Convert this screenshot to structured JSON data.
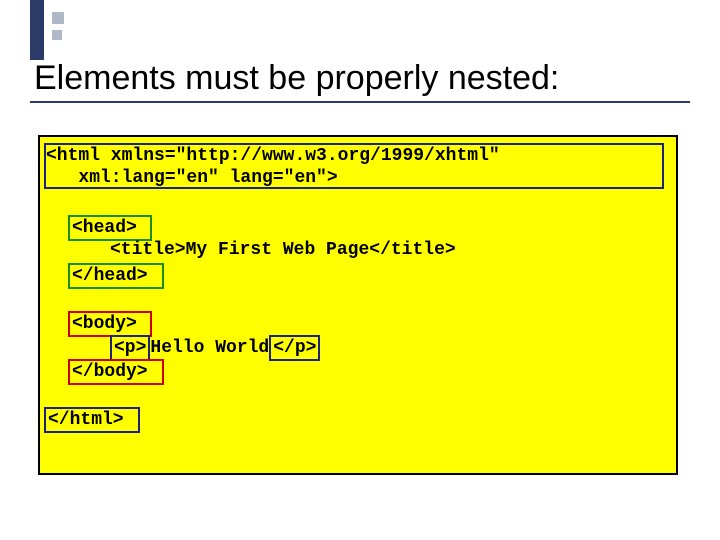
{
  "heading": "Elements must be properly nested:",
  "code": {
    "html_open_line1": "<html xmlns=\"http://www.w3.org/1999/xhtml\"",
    "html_open_line2": "   xml:lang=\"en\" lang=\"en\">",
    "head_open": "<head>",
    "title_open": "<title>",
    "title_text": "My First Web Page",
    "title_close": "</title>",
    "head_close": "</head>",
    "body_open": "<body>",
    "p_open": "<p>",
    "p_text": "Hello World",
    "p_close": "</p>",
    "body_close": "</body>",
    "html_close": "</html>"
  }
}
